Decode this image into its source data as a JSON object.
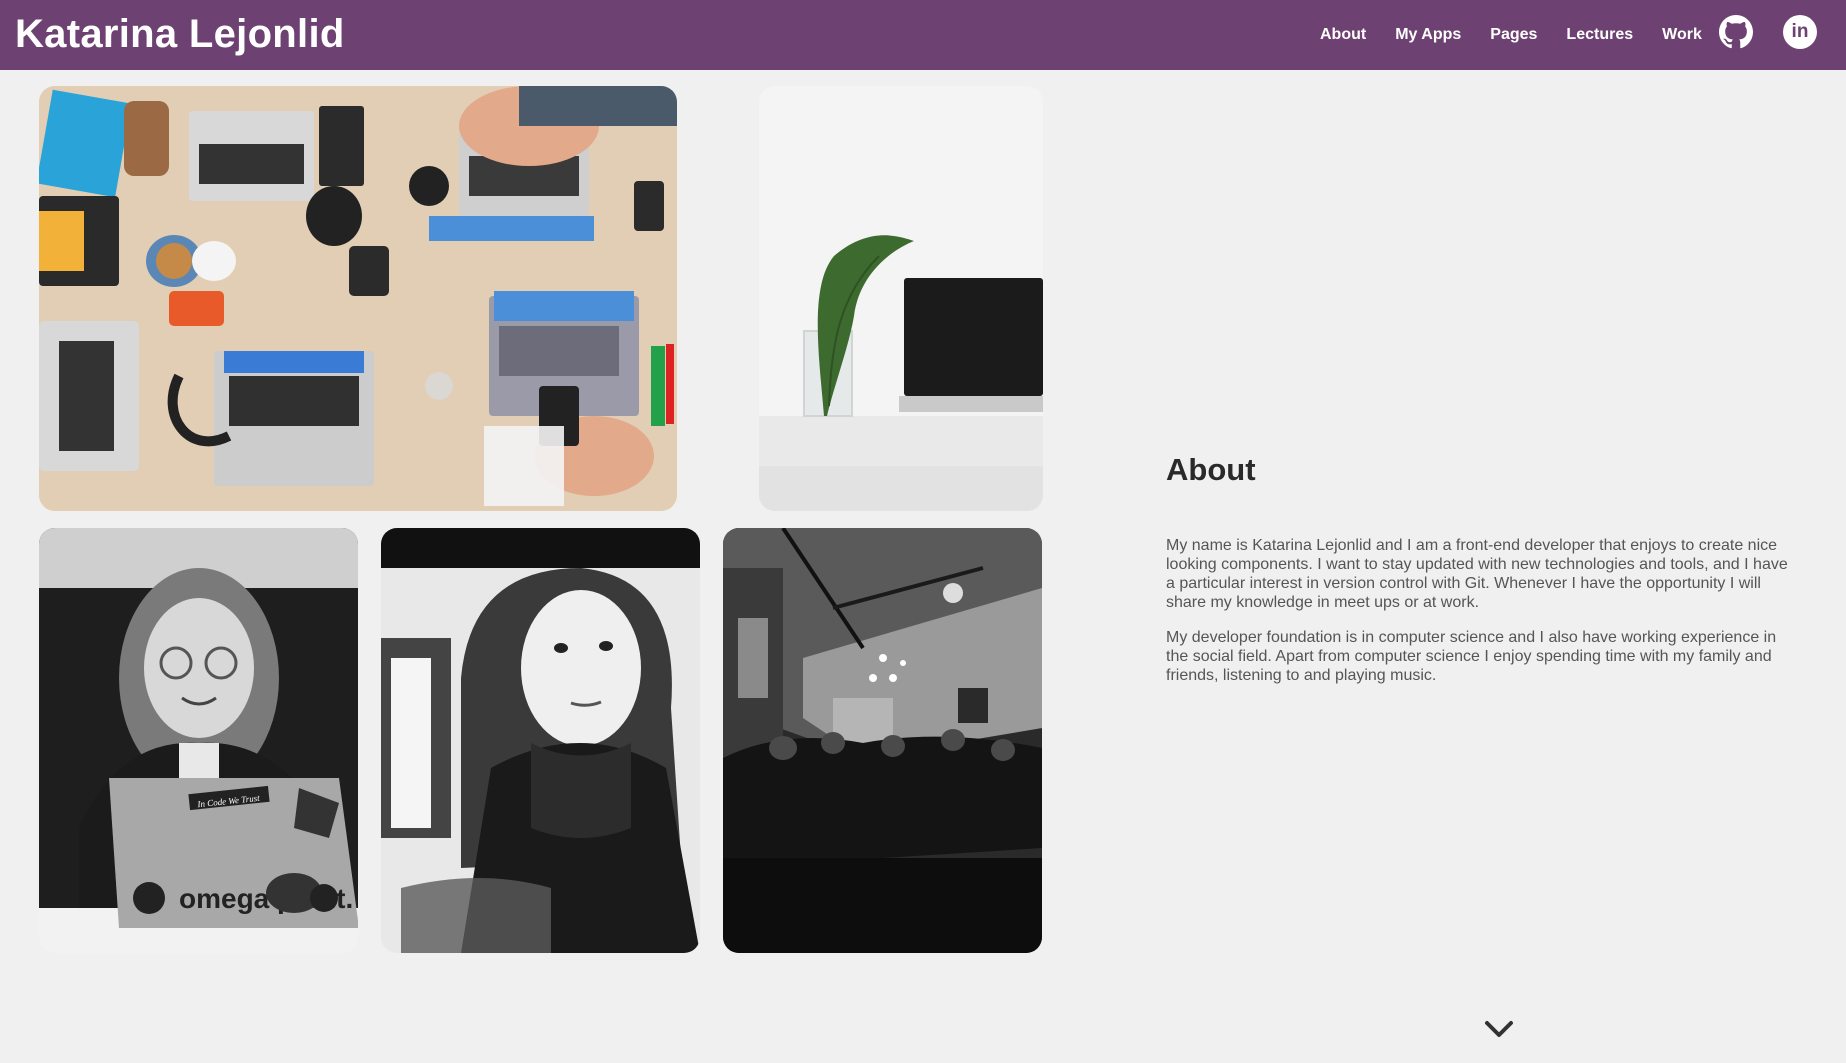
{
  "header": {
    "brand": "Katarina Lejonlid",
    "nav": [
      "About",
      "My Apps",
      "Pages",
      "Lectures",
      "Work"
    ],
    "social": {
      "github_icon": "github-icon",
      "linkedin_icon": "linkedin-icon",
      "linkedin_text": "in"
    }
  },
  "gallery": {
    "photos": [
      "desk-with-laptops-photo",
      "plant-and-laptop-photo",
      "woman-with-laptop-photo",
      "woman-portrait-photo",
      "audience-room-photo"
    ],
    "sticker_text": "In Code We Trust",
    "laptop_text": "omega point."
  },
  "about": {
    "heading": "About",
    "paragraphs": [
      "My name is Katarina Lejonlid and I am a front-end developer that enjoys to create nice looking components. I want to stay updated with new technologies and tools, and I have a particular interest in version control with Git. Whenever I have the opportunity I will share my knowledge in meet ups or at work.",
      "My developer foundation is in computer science and I also have working experience in the social field. Apart from computer science I enjoy spending time with my family and friends, listening to and playing music."
    ]
  },
  "scroll": {
    "icon": "chevron-down-icon"
  },
  "colors": {
    "header_bg": "#6e4173",
    "page_bg": "#f0f0f0",
    "text": "#555555"
  }
}
